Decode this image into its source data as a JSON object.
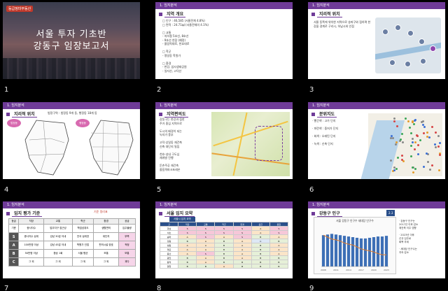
{
  "slides": [
    {
      "num": "1",
      "logo": "등급정미부동산",
      "title_line1": "서울 투자 기초반",
      "title_line2": "강동구 임장보고서"
    },
    {
      "num": "2",
      "section": "1. 임지분석",
      "heading": "지역 개요",
      "lines": [
        "□ 인구 : 46,585 (서울전체 4.8%)",
        "□ 면적 : 24.71㎢ (서울전체의 4.1%)",
        "",
        "□ 교통",
        "  - 지하철 5호선, 8호선",
        "  - 9호선 연장 (예정)",
        "  - 올림픽대로, 천호대로",
        "",
        "□ 학군",
        "  - 명일동 학원가",
        "",
        "□ 환경",
        "  - 한강, 암사생태공원",
        "  - 일자산, 고덕산",
        "",
        "□ 개발 호재",
        "  - 고덕비즈밸리",
        "  - 엔지니어링복합단지"
      ]
    },
    {
      "num": "3",
      "section": "1. 임지분석",
      "heading": "지리적 위치",
      "desc": "서울 동쪽에 위치한 지역으로 송파구와 접하며 한강을 경계로 구리시, 하남시와 인접"
    },
    {
      "num": "4",
      "section": "1. 임지분석",
      "heading": "지리적 위치",
      "desc": "법정구역 : 법정동 9개 동, 행정동 18개 동",
      "bubble1": "법정동",
      "bubble2": "행정동"
    },
    {
      "num": "5",
      "section": "1. 임지분석",
      "heading": "지역편의도",
      "lines": [
        "강동구는 한강과 접한",
        "주거 중심 지역으로",
        "",
        "도시의 배경이 되는",
        "녹지가 풍부",
        "",
        "고덕·상일동 재건축",
        "신축 대단지 밀집",
        "",
        "천호·성내 구도심",
        "재개발 진행",
        "",
        "둔촌주공 재건축",
        "올림픽파크포레온",
        "",
        "상일동 첨단업무단지"
      ]
    },
    {
      "num": "6",
      "section": "1. 임지분석",
      "heading": "분위지도",
      "notes": [
        "· 빨간색 : 고가 단지",
        "· 파란색 : 중저가 단지",
        "· 회색 : 오래된 단지",
        "· 녹색 : 신축 단지"
      ]
    },
    {
      "num": "7",
      "section": "1. 임지분석",
      "heading": "임지 평가 기준",
      "caption": "기준 정리표",
      "table": {
        "headers": [
          "등급",
          "직장",
          "교통",
          "학군",
          "환경",
          "공급"
        ],
        "rows": [
          [
            "기준",
            "종사자수",
            "업무지구 접근성",
            "학업성취도",
            "생활편의",
            "입주물량"
          ],
          [
            "S",
            "종사자수 상위",
            "강남 30분 이내",
            "전국 상위권",
            "대단지",
            "부족"
          ],
          [
            "A",
            "100만명 이상",
            "강남 45분 이내",
            "학원가 인접",
            "편의시설 양호",
            "적정"
          ],
          [
            "B",
            "50만명 이상",
            "환승 1회",
            "서울 평균",
            "보통",
            "보통"
          ],
          [
            "C",
            "그 외",
            "그 외",
            "그 외",
            "그 외",
            "과다"
          ]
        ]
      }
    },
    {
      "num": "8",
      "section": "1. 임지분석",
      "heading": "서울 입지 요약",
      "table_title": "서울시 입지 요약",
      "cols": [
        "구",
        "직장",
        "교통",
        "학군",
        "환경",
        "공급",
        "종합"
      ],
      "rows": [
        [
          "강남",
          "S",
          "S",
          "S",
          "S",
          "A",
          "S"
        ],
        [
          "서초",
          "S",
          "S",
          "S",
          "S",
          "A",
          "S"
        ],
        [
          "송파",
          "A",
          "S",
          "A",
          "S",
          "B",
          "A"
        ],
        [
          "강동",
          "B",
          "A",
          "B",
          "A",
          "C",
          "B"
        ],
        [
          "성동",
          "A",
          "A",
          "B",
          "A",
          "B",
          "A"
        ],
        [
          "마포",
          "A",
          "A",
          "B",
          "A",
          "B",
          "A"
        ],
        [
          "용산",
          "A",
          "S",
          "B",
          "A",
          "B",
          "A"
        ],
        [
          "광진",
          "B",
          "A",
          "B",
          "A",
          "B",
          "B"
        ],
        [
          "동작",
          "B",
          "A",
          "B",
          "B",
          "B",
          "B"
        ],
        [
          "양천",
          "B",
          "B",
          "A",
          "B",
          "B",
          "B"
        ]
      ]
    },
    {
      "num": "9",
      "section": "1. 임지분석",
      "heading": "강동구 인구",
      "chart_title": "서울 강동구 인구수 세대당 인구수",
      "badge": "2.3",
      "notes": [
        "· 강동구 인구는",
        "  2017년 이후 감소",
        "  재건축 이주 영향",
        "",
        "· 2023년 이후",
        "  신규 입주로",
        "  회복 추세",
        "",
        "· 세대당 인구수는",
        "  지속 감소"
      ]
    }
  ],
  "chart_data": {
    "type": "bar",
    "title": "서울 강동구 인구수 세대당 인구수",
    "categories": [
      "2008",
      "2009",
      "2010",
      "2011",
      "2012",
      "2013",
      "2014",
      "2015",
      "2016",
      "2017",
      "2018",
      "2019",
      "2020",
      "2021",
      "2022",
      "2023"
    ],
    "series": [
      {
        "name": "",
        "values": [
          48,
          49,
          50,
          49,
          48,
          47,
          46,
          45,
          44,
          43,
          43,
          44,
          45,
          46,
          46,
          47
        ]
      },
      {
        "name": "",
        "values": [
          2.8,
          2.75,
          2.7,
          2.68,
          2.65,
          2.6,
          2.57,
          2.55,
          2.5,
          2.45,
          2.42,
          2.4,
          2.37,
          2.33,
          2.3,
          2.3
        ]
      }
    ]
  }
}
